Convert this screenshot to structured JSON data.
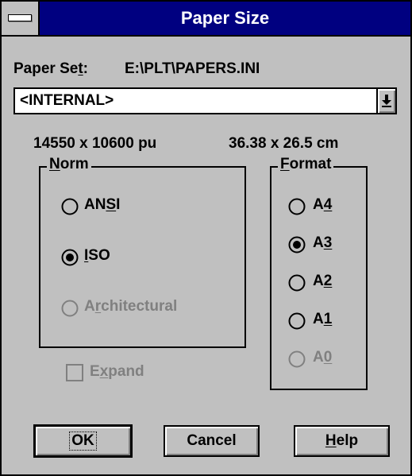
{
  "window": {
    "title": "Paper Size"
  },
  "paper_set": {
    "label_pre": "Paper Se",
    "label_mnemonic": "t",
    "label_post": ":",
    "path": "E:\\PLT\\PAPERS.INI"
  },
  "combo": {
    "value": "<INTERNAL>"
  },
  "dimensions": {
    "units": "14550 x 10600 pu",
    "metric": "36.38 x 26.5 cm"
  },
  "norm": {
    "title_mnemonic": "N",
    "title_rest": "orm",
    "ansi": {
      "pre": "AN",
      "mnemonic": "S",
      "post": "I",
      "selected": false,
      "enabled": true
    },
    "iso": {
      "pre": "",
      "mnemonic": "I",
      "post": "SO",
      "selected": true,
      "enabled": true
    },
    "architectural": {
      "pre": "A",
      "mnemonic": "r",
      "post": "chitectural",
      "selected": false,
      "enabled": false
    }
  },
  "format": {
    "title_mnemonic": "F",
    "title_rest": "ormat",
    "a4": {
      "pre": "A",
      "mnemonic": "4",
      "selected": false,
      "enabled": true
    },
    "a3": {
      "pre": "A",
      "mnemonic": "3",
      "selected": true,
      "enabled": true
    },
    "a2": {
      "pre": "A",
      "mnemonic": "2",
      "selected": false,
      "enabled": true
    },
    "a1": {
      "pre": "A",
      "mnemonic": "1",
      "selected": false,
      "enabled": true
    },
    "a0": {
      "pre": "A",
      "mnemonic": "0",
      "selected": false,
      "enabled": false
    }
  },
  "expand": {
    "pre": "E",
    "mnemonic": "x",
    "post": "pand",
    "checked": false,
    "enabled": false
  },
  "buttons": {
    "ok": "OK",
    "cancel": "Cancel",
    "help_mnemonic": "H",
    "help_rest": "elp"
  }
}
